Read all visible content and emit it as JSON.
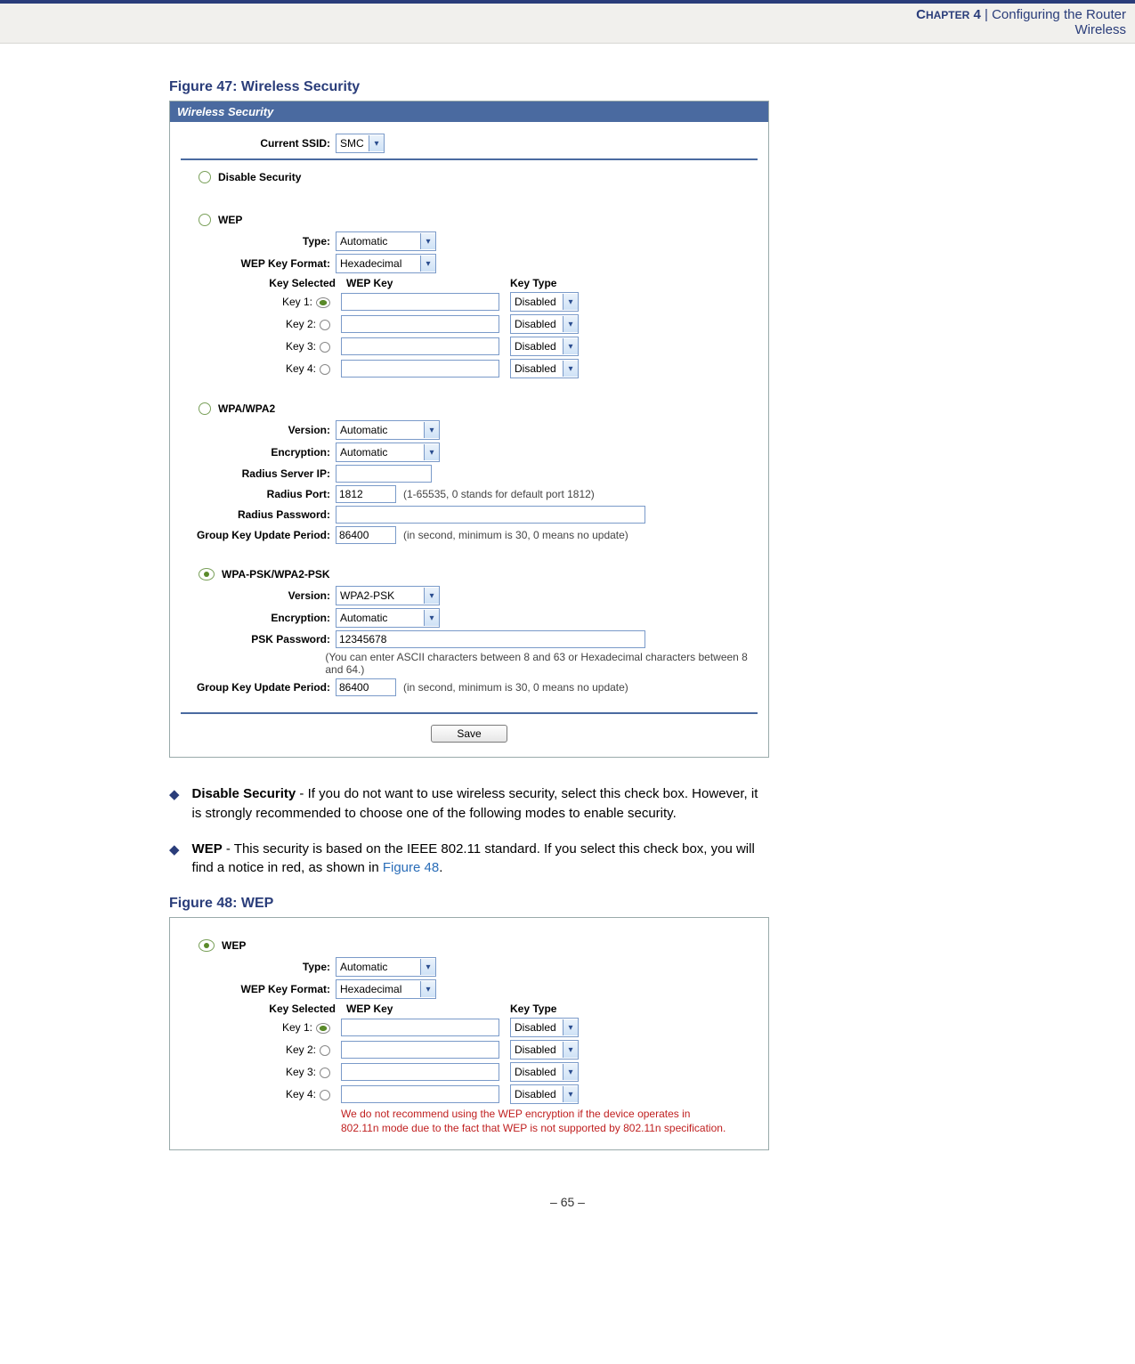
{
  "header": {
    "chapter_prefix": "C",
    "chapter_word": "HAPTER",
    "chapter_num": " 4",
    "sep": "  |  ",
    "title": "Configuring the Router",
    "subtitle": "Wireless"
  },
  "fig47": {
    "caption": "Figure 47:  Wireless Security",
    "panel_title": "Wireless Security",
    "ssid_label": "Current SSID:",
    "ssid_value": "SMC",
    "disable_label": "Disable Security",
    "wep": {
      "section": "WEP",
      "type_label": "Type:",
      "type_value": "Automatic",
      "format_label": "WEP Key Format:",
      "format_value": "Hexadecimal",
      "keysel_label": "Key Selected",
      "wepkey_label": "WEP Key",
      "keytype_label": "Key Type",
      "keys": [
        {
          "label": "Key 1:",
          "type": "Disabled",
          "selected": true
        },
        {
          "label": "Key 2:",
          "type": "Disabled",
          "selected": false
        },
        {
          "label": "Key 3:",
          "type": "Disabled",
          "selected": false
        },
        {
          "label": "Key 4:",
          "type": "Disabled",
          "selected": false
        }
      ]
    },
    "wpa": {
      "section": "WPA/WPA2",
      "version_label": "Version:",
      "version_value": "Automatic",
      "enc_label": "Encryption:",
      "enc_value": "Automatic",
      "radius_ip_label": "Radius Server IP:",
      "radius_port_label": "Radius Port:",
      "radius_port_value": "1812",
      "radius_port_hint": "(1-65535, 0 stands for default port 1812)",
      "radius_pwd_label": "Radius Password:",
      "gkup_label": "Group Key Update Period:",
      "gkup_value": "86400",
      "gkup_hint": "(in second, minimum is 30, 0 means no update)"
    },
    "psk": {
      "section": "WPA-PSK/WPA2-PSK",
      "version_label": "Version:",
      "version_value": "WPA2-PSK",
      "enc_label": "Encryption:",
      "enc_value": "Automatic",
      "pwd_label": "PSK Password:",
      "pwd_value": "12345678",
      "pwd_hint": "(You can enter ASCII characters between 8 and 63 or Hexadecimal characters between 8 and 64.)",
      "gkup_label": "Group Key Update Period:",
      "gkup_value": "86400",
      "gkup_hint": "(in second, minimum is 30, 0 means no update)"
    },
    "save": "Save"
  },
  "body": {
    "item1_label": "Disable Security",
    "item1_text": " - If you do not want to use wireless security, select this check box. However, it is strongly recommended to choose one of the following modes to enable security.",
    "item2_label": "WEP",
    "item2_text_a": " - This security is based on the IEEE 802.11 standard. If you select this check box, you will find a notice in red, as shown in ",
    "item2_link": "Figure 48",
    "item2_text_b": "."
  },
  "fig48": {
    "caption": "Figure 48:  WEP",
    "section": "WEP",
    "type_label": "Type:",
    "type_value": "Automatic",
    "format_label": "WEP Key Format:",
    "format_value": "Hexadecimal",
    "keysel_label": "Key Selected",
    "wepkey_label": "WEP Key",
    "keytype_label": "Key Type",
    "keys": [
      {
        "label": "Key 1:",
        "type": "Disabled",
        "selected": true
      },
      {
        "label": "Key 2:",
        "type": "Disabled",
        "selected": false
      },
      {
        "label": "Key 3:",
        "type": "Disabled",
        "selected": false
      },
      {
        "label": "Key 4:",
        "type": "Disabled",
        "selected": false
      }
    ],
    "warn1": "We do not recommend using the WEP encryption if the device operates in",
    "warn2": "802.11n mode due to the fact that WEP is not supported by 802.11n specification."
  },
  "footer": "–  65  –"
}
